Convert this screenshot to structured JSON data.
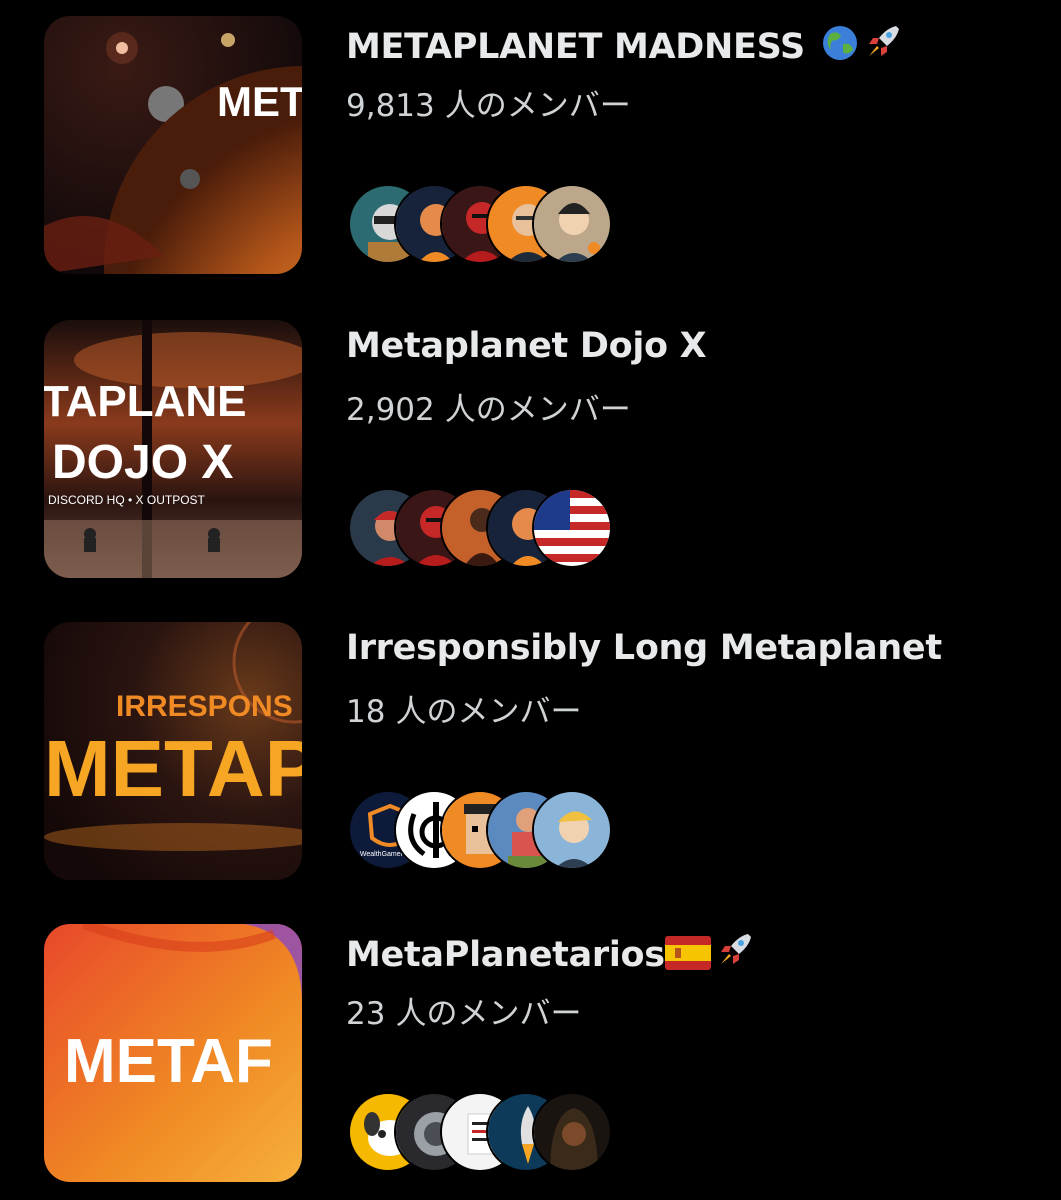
{
  "communities": [
    {
      "name": "METAPLANET MADNESS",
      "emoji": [
        "globe-emoji",
        "rocket-emoji"
      ],
      "member_count": "9,813",
      "member_unit": "人のメンバー",
      "thumbnail_text": "MET",
      "avatars": [
        "raccoon-avatar",
        "smiling-man-avatar",
        "red-mask-avatar",
        "man-glasses-avatar",
        "anime-man-avatar"
      ]
    },
    {
      "name": "Metaplanet Dojo X",
      "emoji": [],
      "member_count": "2,902",
      "member_unit": "人のメンバー",
      "thumbnail_text": "TAPLANE",
      "thumbnail_sub": "DOJO X",
      "thumbnail_caption": "DISCORD HQ • X OUTPOST",
      "avatars": [
        "red-cap-avatar",
        "red-mask-avatar",
        "figure-avatar",
        "smiling-man-avatar",
        "us-flag-avatar"
      ]
    },
    {
      "name": "Irresponsibly Long Metaplanet",
      "emoji": [],
      "member_count": "18",
      "member_unit": "人のメンバー",
      "thumbnail_text": "METAP",
      "thumbnail_sub": "IRRESPONS",
      "avatars": [
        "wealthgamehacks-avatar",
        "khanda-avatar",
        "pixel-punk-avatar",
        "wrestler-avatar",
        "blond-man-avatar"
      ]
    },
    {
      "name": "MetaPlanetarios",
      "emoji": [
        "spain-flag-emoji",
        "rocket-emoji"
      ],
      "member_count": "23",
      "member_unit": "人のメンバー",
      "thumbnail_text": "METAF",
      "avatars": [
        "dog-avatar",
        "badge-avatar",
        "mug-avatar",
        "rocket-avatar",
        "hooded-man-avatar"
      ]
    }
  ],
  "avatar_labels": {
    "wealthgamehacks": "WealthGameHacks"
  },
  "colors": {
    "background": "#000000",
    "title": "#e7e9ea",
    "subtitle": "#d0d3d5",
    "orange": "#f08a24"
  }
}
